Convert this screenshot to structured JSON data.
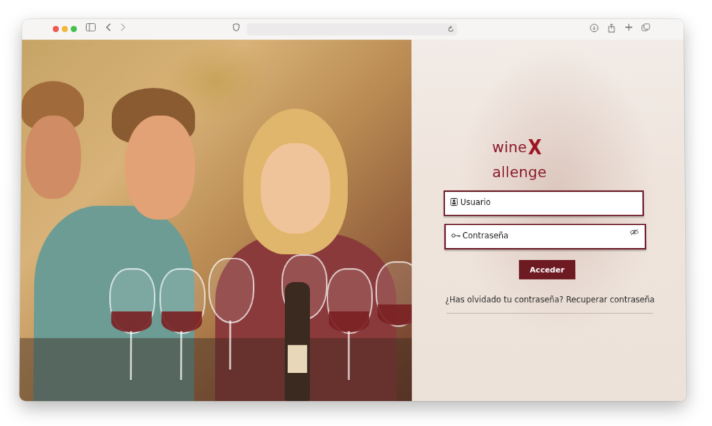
{
  "browser": {
    "icons": {
      "sidebar": "sidebar-icon",
      "back": "chevron-left-icon",
      "forward": "chevron-right-icon",
      "shield": "privacy-shield-icon",
      "reload": "reload-icon",
      "download": "download-icon",
      "share": "share-icon",
      "new_tab": "plus-icon",
      "tabs": "tabs-overview-icon"
    },
    "url": ""
  },
  "hero": {
    "image_alt": ""
  },
  "login": {
    "logo": {
      "part1": "wine",
      "x": "X",
      "part2": "allenge"
    },
    "username_label": "Usuario",
    "password_label": "Contraseña",
    "submit_label": "Acceder",
    "forgot_text": "¿Has olvidado tu contraseña? Recuperar contraseña"
  },
  "colors": {
    "brand": "#8b1a2b",
    "button": "#6e1a22",
    "field_border": "#6c1a24"
  }
}
